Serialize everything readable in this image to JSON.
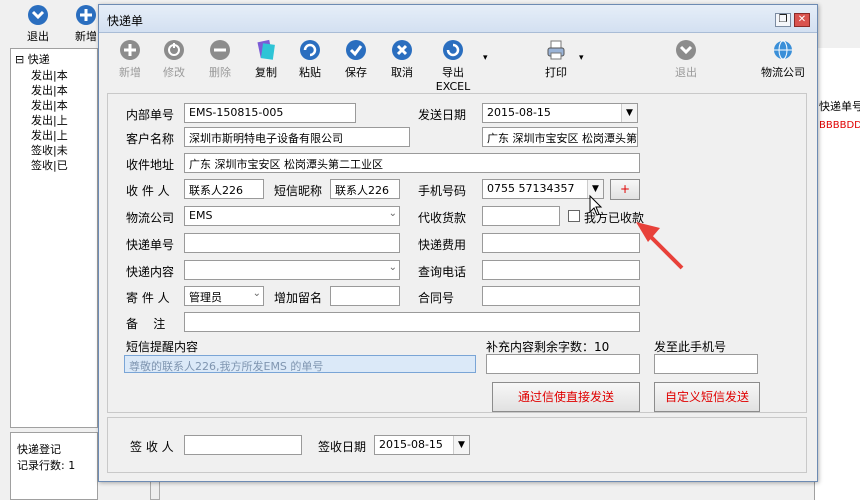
{
  "bg_app": {
    "toolbar": [
      {
        "label": "退出",
        "icon": "exit-icon"
      },
      {
        "label": "新增",
        "icon": "add-icon"
      }
    ],
    "tree_root": "快递",
    "tree_items": [
      "发出|本",
      "发出|本",
      "发出|本",
      "发出|上",
      "发出|上",
      "签收|未",
      "签收|已"
    ],
    "right_header": "快递单号",
    "right_cell": "BBBBDD",
    "status_title": "快递登记",
    "status_count": "记录行数: 1"
  },
  "dialog": {
    "title": "快递单",
    "toolbar": [
      {
        "label": "新增",
        "icon": "plus-circle-icon",
        "disabled": true
      },
      {
        "label": "修改",
        "icon": "edit-circle-icon",
        "disabled": true
      },
      {
        "label": "删除",
        "icon": "minus-circle-icon",
        "disabled": true
      },
      {
        "label": "复制",
        "icon": "copy-icon",
        "disabled": false
      },
      {
        "label": "粘贴",
        "icon": "paste-icon",
        "disabled": false
      },
      {
        "label": "保存",
        "icon": "save-check-icon",
        "disabled": false
      },
      {
        "label": "取消",
        "icon": "cancel-x-icon",
        "disabled": false
      },
      {
        "label": "导出EXCEL",
        "icon": "export-excel-icon",
        "disabled": false
      },
      {
        "label": "打印",
        "icon": "print-icon",
        "disabled": false
      },
      {
        "label": "退出",
        "icon": "exit-icon",
        "disabled": true
      },
      {
        "label": "物流公司",
        "icon": "logistics-globe-icon",
        "disabled": false
      }
    ],
    "form": {
      "internal_no_label": "内部单号",
      "internal_no": "EMS-150815-005",
      "send_date_label": "发送日期",
      "send_date": "2015-08-15",
      "customer_label": "客户名称",
      "customer": "深圳市斯明特电子设备有限公司",
      "customer_region": "广东 深圳市宝安区 松岗潭头第",
      "address_label": "收件地址",
      "address": "广东 深圳市宝安区 松岗潭头第二工业区",
      "receiver_label": "收 件 人",
      "receiver": "联系人226",
      "sms_nick_label": "短信昵称",
      "sms_nick": "联系人226",
      "mobile_label": "手机号码",
      "mobile": "0755 57134357",
      "plus_label": "+",
      "logistics_label": "物流公司",
      "logistics": "EMS",
      "cod_label": "代收货款",
      "cod": "",
      "received_chk_label": "我方已收款",
      "tracking_label": "快递单号",
      "tracking": "",
      "fee_label": "快递费用",
      "fee": "",
      "content_label": "快递内容",
      "content": "",
      "query_phone_label": "查询电话",
      "query_phone": "",
      "sender_label": "寄 件 人",
      "sender": "管理员",
      "extra_msg_label": "增加留名",
      "extra_msg": "",
      "contract_label": "合同号",
      "contract": "",
      "remark_label": "备    注",
      "remark": "",
      "sms_content_label": "短信提醒内容",
      "sms_content": "尊敬的联系人226,我方所发EMS 的单号",
      "remaining_label": "补充内容剩余字数：10",
      "remaining_input": "",
      "send_to_label": "发至此手机号",
      "send_to": "",
      "send_direct_btn": "通过信使直接发送",
      "custom_sms_btn": "自定义短信发送"
    },
    "sign": {
      "signer_label": "签 收 人",
      "signer": "",
      "sign_date_label": "签收日期",
      "sign_date": "2015-08-15"
    }
  },
  "colors": {
    "accent": "#2a6ebf",
    "annotation_arrow": "#e8413a",
    "red_text": "#e00000"
  }
}
